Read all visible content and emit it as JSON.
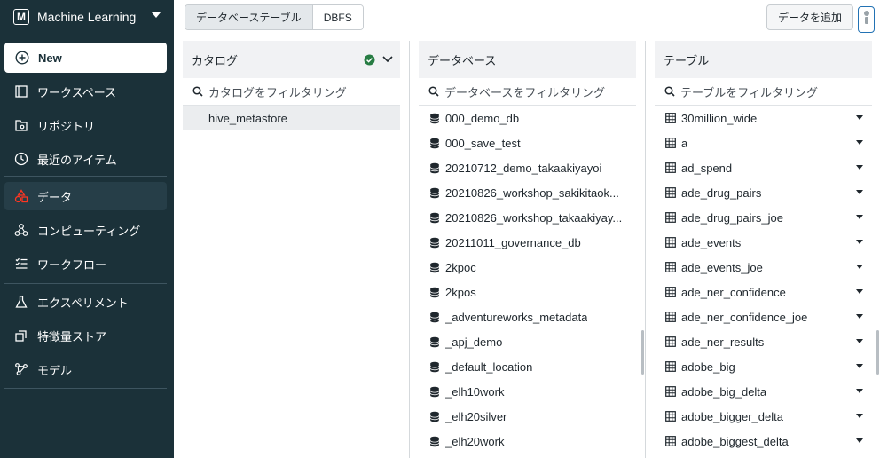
{
  "workspace": {
    "logo_letter": "M",
    "name": "Machine Learning"
  },
  "sidebar": {
    "new_label": "New",
    "items": [
      {
        "label": "ワークスペース",
        "icon": "workspace-icon"
      },
      {
        "label": "リポジトリ",
        "icon": "repos-icon"
      },
      {
        "label": "最近のアイテム",
        "icon": "clock-icon"
      },
      {
        "label": "データ",
        "icon": "data-icon",
        "active": true
      },
      {
        "label": "コンピューティング",
        "icon": "compute-icon"
      },
      {
        "label": "ワークフロー",
        "icon": "workflow-icon"
      },
      {
        "label": "エクスペリメント",
        "icon": "flask-icon"
      },
      {
        "label": "特徴量ストア",
        "icon": "feature-store-icon"
      },
      {
        "label": "モデル",
        "icon": "models-icon"
      }
    ]
  },
  "topbar": {
    "tabs": [
      "データベーステーブル",
      "DBFS"
    ],
    "selected_tab": "データベーステーブル",
    "add_data_label": "データを追加"
  },
  "catalog": {
    "header": "カタログ",
    "filter_placeholder": "カタログをフィルタリング",
    "items": [
      "hive_metastore"
    ]
  },
  "database": {
    "header": "データベース",
    "filter_placeholder": "データベースをフィルタリング",
    "items": [
      "000_demo_db",
      "000_save_test",
      "20210712_demo_takaakiyayoi",
      "20210826_workshop_sakikitaok...",
      "20210826_workshop_takaakiyay...",
      "20211011_governance_db",
      "2kpoc",
      "2kpos",
      "_adventureworks_metadata",
      "_apj_demo",
      "_default_location",
      "_elh10work",
      "_elh20silver",
      "_elh20work"
    ]
  },
  "table": {
    "header": "テーブル",
    "filter_placeholder": "テーブルをフィルタリング",
    "items": [
      "30million_wide",
      "a",
      "ad_spend",
      "ade_drug_pairs",
      "ade_drug_pairs_joe",
      "ade_events",
      "ade_events_joe",
      "ade_ner_confidence",
      "ade_ner_confidence_joe",
      "ade_ner_results",
      "adobe_big",
      "adobe_big_delta",
      "adobe_bigger_delta",
      "adobe_biggest_delta"
    ]
  },
  "colors": {
    "sidebar_bg": "#1b3139",
    "active_item_bg": "#263e48",
    "data_icon": "#ff3621",
    "check_green": "#277c43",
    "accent_blue": "#2272b4"
  }
}
